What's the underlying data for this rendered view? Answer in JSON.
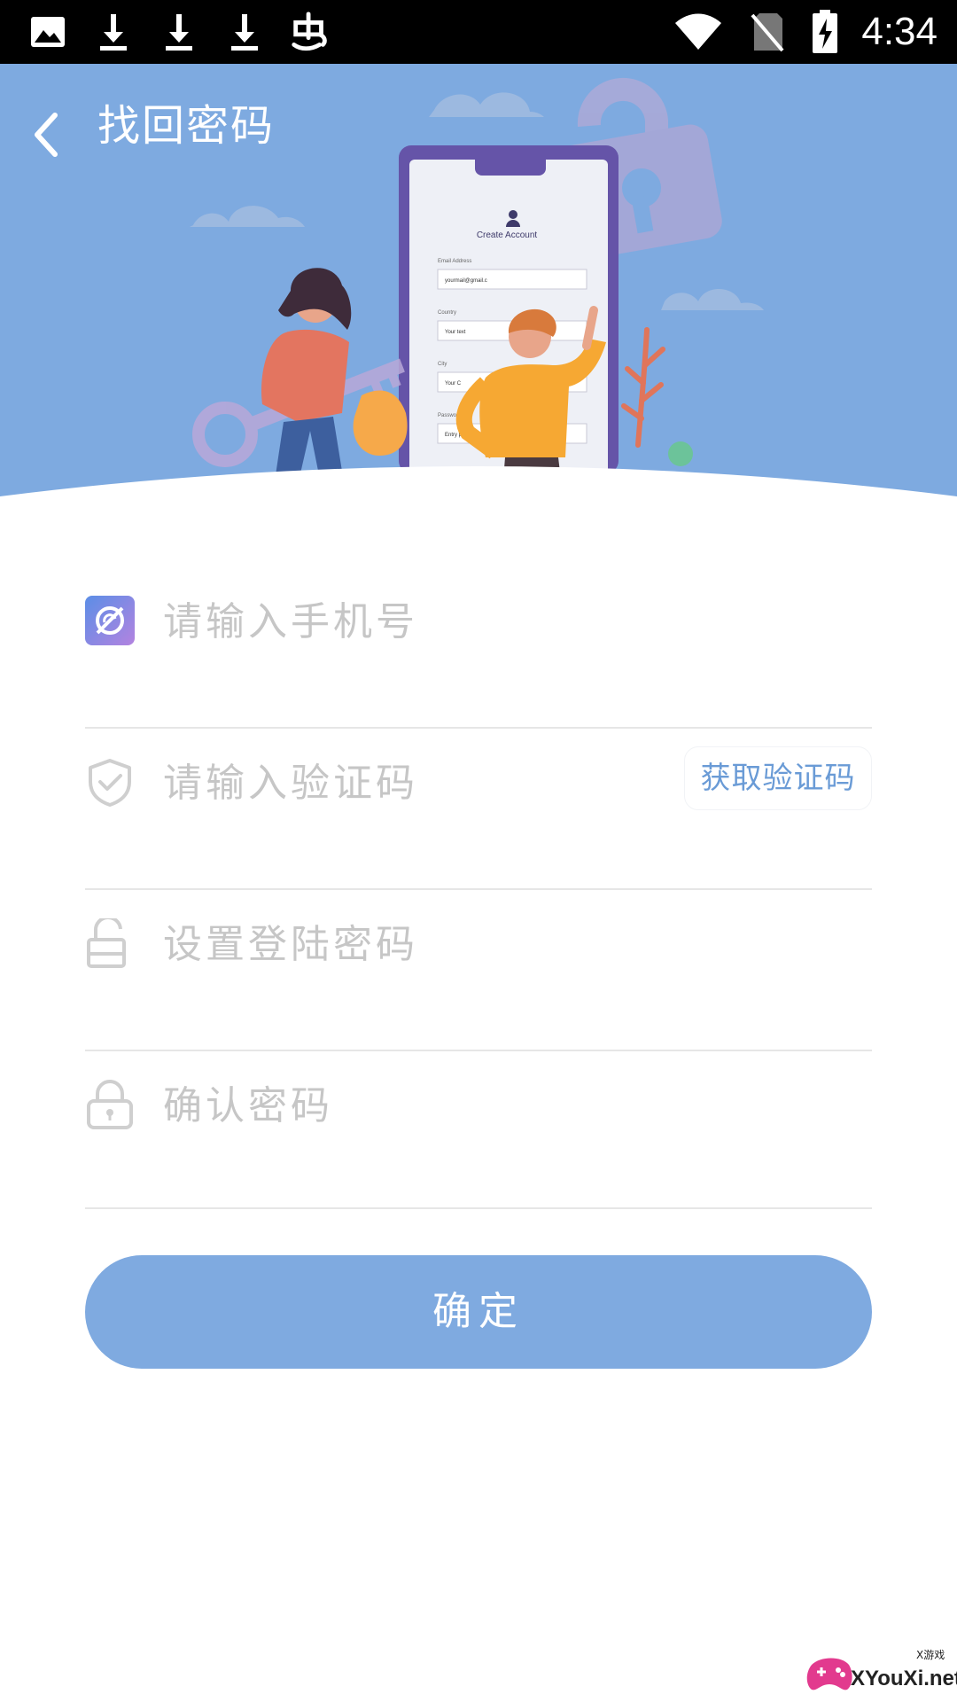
{
  "status_bar": {
    "time": "4:34",
    "left_icons": [
      "image-icon",
      "download-icon",
      "download-icon",
      "download-icon",
      "app-notification-icon"
    ],
    "right_icons": [
      "wifi-icon",
      "no-sim-icon",
      "battery-charging-icon"
    ]
  },
  "header": {
    "title": "找回密码",
    "background_color": "#7eaae0",
    "illustration": {
      "form_title": "Create Account",
      "fields": [
        "Email Address",
        "Country",
        "City",
        "Password"
      ],
      "values": [
        "yourmail@gmail.c",
        "Your text",
        "Your C",
        "Entry password"
      ]
    }
  },
  "form": {
    "phone_placeholder": "请输入手机号",
    "code_placeholder": "请输入验证码",
    "get_code_label": "获取验证码",
    "password_placeholder": "设置登陆密码",
    "confirm_placeholder": "确认密码"
  },
  "submit_label": "确定",
  "watermark": {
    "brand": "XYouXi.net",
    "small": "X游戏"
  },
  "colors": {
    "accent": "#7faae0",
    "link": "#6a9bd6",
    "placeholder": "#c6c6c6"
  }
}
